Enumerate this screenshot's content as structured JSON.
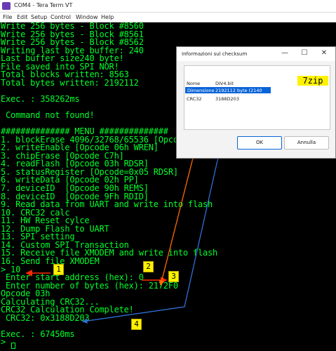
{
  "window": {
    "title": "COM4 - Tera Term VT",
    "menu": [
      "File",
      "Edit",
      "Setup",
      "Control",
      "Window",
      "Help"
    ]
  },
  "terminal": {
    "lines": [
      "Write 256 bytes - Block #8560",
      "Write 256 bytes - Block #8561",
      "Write 256 bytes - Block #8562",
      "Writing last byte buffer: 240",
      "Last buffer size240 byte!",
      "File saved into SPI NOR!",
      "Total blocks written: 8563",
      "Total bytes written: 2192112",
      "",
      "Exec. : 358262ms",
      "",
      " Command not found!",
      "",
      "############## MENU ##############",
      "1. blockErase 4096/32768/65536 [Opcode 2",
      "2. writeEnable [Opcode 06h WREN]",
      "3. chipErase [Opcode C7h]",
      "4. readFlash [Opcode 03h RDSR]",
      "5. statusRegister [Opcode=0x05 RDSR]",
      "6. writeData [Opcode 02h PP]",
      "7. deviceID  [Opcode 90h REMS]",
      "8. deviceID  [Opcode 9Fh RDID]",
      "9. Read data from UART and write into flash",
      "10. CRC32 calc",
      "11. HW Reset cylce",
      "12. Dump Flash to UART",
      "13. SPI setting",
      "14. Custom SPI Transaction",
      "15. Receive file XMODEM and write into flash",
      "16. Send file XMODEM",
      "> 10",
      " Enter start address (hex): 0",
      " Enter number of bytes (hex): 2172F0",
      "Opcode 03h",
      "Calculating CRC32...",
      "CRC32 Calculation Complete!",
      " CRC32: 0x3188D203",
      "",
      "Exec. : 67450ms",
      "> "
    ]
  },
  "dialog": {
    "title": "Informazioni sul checksum",
    "rows": [
      {
        "label": "Nome",
        "value": "DIV4.bit"
      },
      {
        "label": "Dimensione",
        "value": "2192112 byte (2140 KiB)"
      },
      {
        "label": "CRC32",
        "value": "3188D203"
      }
    ],
    "ok_label": "OK",
    "cancel_label": "Annulla",
    "minimize_glyph": "—",
    "maximize_glyph": "☐",
    "close_glyph": "✕"
  },
  "annotations": {
    "tool_label": "7zip",
    "markers": [
      "1",
      "2",
      "3",
      "4"
    ]
  },
  "colors": {
    "terminal_text": "#00ff2a",
    "terminal_bg": "#000000",
    "highlight_yellow": "#fff200",
    "arrow_red": "#ff2a00",
    "arrow_orange": "#ff6a00",
    "arrow_blue": "#2f6fd6",
    "selection_blue": "#0a64d8"
  }
}
